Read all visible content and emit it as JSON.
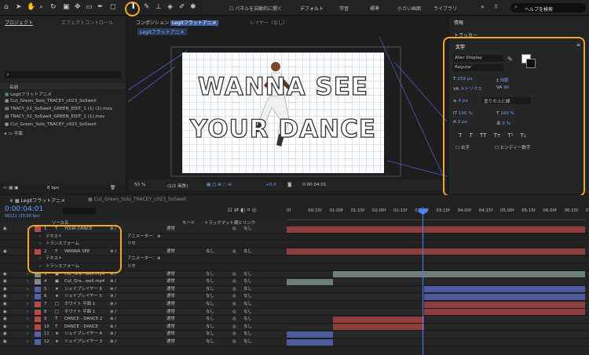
{
  "toolbar": {
    "auto_open": "パネルを自動的に開く",
    "workspaces": [
      "デフォルト",
      "学習",
      "標準",
      "小さい画面",
      "ライブラリ"
    ],
    "search_placeholder": "ヘルプを検索"
  },
  "project": {
    "tab_project": "プロジェクト",
    "tab_effects": "エフェクトコントロール",
    "search_glyph": "⌕",
    "col_name": "名前",
    "items": [
      "Legitフラットアニメ",
      "Cut_Green_Solo_TRACEY_c023_SoSwell",
      "TRACY_02_SoSwell_GREEN_EDIT_1 (1) (1).mov",
      "TRACY_02_SoSwell_GREEN_EDIT_1 (1).mov",
      "Cut_Green_Solo_TRACEY_c023_SoSwell",
      "平面"
    ],
    "bpc": "8 bpc"
  },
  "comp": {
    "tab": "コンポジション",
    "comp_name": "Legitフラットアニメ",
    "layer_tab": "レイヤー（なし）",
    "subtab": "Legitフラットアニメ",
    "line1": "WANNA SEE",
    "line2": "YOUR DANCE",
    "zoom": "50 %",
    "quality": "(1/2 画質)",
    "exposure": "+0.0",
    "time": "0:00:04:01"
  },
  "right": {
    "info": "情報",
    "tracker": "トラッカー",
    "char_title": "文字",
    "font": "Aller Display",
    "style": "Regular",
    "size": "259 px",
    "leading": "自動",
    "kerning": "メトリクス",
    "tracking": "96",
    "stroke_width": "4 px",
    "stroke_mode": "塗りの上に線",
    "vscale": "100 %",
    "hscale": "100 %",
    "baseline": "0 px",
    "tsume": "0 %",
    "styles": [
      "T",
      "T",
      "TT",
      "Tт",
      "T¹",
      "T₁"
    ],
    "opt1": "合字",
    "opt2": "ヒンディー数字"
  },
  "timeline": {
    "tab1": "Legitフラットアニメ",
    "tab2": "Cut_Green_Solo_TRACEY_c023_SoSwell",
    "timecode": "0:00:04:01",
    "frame_info": "00121 (30.00 fps)",
    "col_source": "ソース名",
    "col_mode": "モード",
    "col_trk": "トラックマット",
    "col_parent": "親とリンク",
    "ruler": [
      "0f",
      "00:15f",
      "01:00f",
      "01:15f",
      "02:00f",
      "02:15f",
      "03:00f",
      "03:15f",
      "04:00f",
      "04:15f",
      "05:00f",
      "05:15f",
      "06:00f",
      "06:15f",
      "07:00f"
    ],
    "layers": [
      {
        "num": "1",
        "type": "T",
        "name": "YOUR DANCE",
        "mode": "通常",
        "trk": "",
        "parent": "なし",
        "color": "#b94a4a",
        "bar": "#8e3e3e",
        "start": 0,
        "end": 1
      },
      {
        "num": "",
        "type": "",
        "name": "テキスト",
        "mode": "",
        "trk": "",
        "parent": "",
        "color": "",
        "bar": "",
        "start": 0,
        "end": 0,
        "extra": "アニメーター："
      },
      {
        "num": "",
        "type": "",
        "name": "トランスフォーム",
        "mode": "",
        "trk": "",
        "parent": "",
        "color": "",
        "bar": "",
        "start": 0,
        "end": 0,
        "extra": "リセ"
      },
      {
        "num": "2",
        "type": "T",
        "name": "WANNA SEE",
        "mode": "通常",
        "trk": "なし",
        "parent": "なし",
        "color": "#b94a4a",
        "bar": "#8e3e3e",
        "start": 0,
        "end": 1
      },
      {
        "num": "",
        "type": "",
        "name": "テキスト",
        "mode": "",
        "trk": "",
        "parent": "",
        "color": "",
        "bar": "",
        "start": 0,
        "end": 0,
        "extra": "アニメーター："
      },
      {
        "num": "",
        "type": "",
        "name": "トランスフォーム",
        "mode": "",
        "trk": "",
        "parent": "",
        "color": "",
        "bar": "",
        "start": 0,
        "end": 0,
        "extra": "リセ"
      },
      {
        "num": "3",
        "type": "▣",
        "name": "Cut_Gra...well.mp4",
        "mode": "通常",
        "trk": "なし",
        "parent": "なし",
        "color": "#7d8c86",
        "bar": "#6e7f79",
        "start": 0.155,
        "end": 1
      },
      {
        "num": "4",
        "type": "▣",
        "name": "Cut_Gra...well.mp4",
        "mode": "通常",
        "trk": "なし",
        "parent": "なし",
        "color": "#7d8c86",
        "bar": "#6e7f79",
        "start": 0,
        "end": 0.155
      },
      {
        "num": "5",
        "type": "★",
        "name": "シェイプレイヤー 6",
        "mode": "通常",
        "trk": "なし",
        "parent": "なし",
        "color": "#5560a8",
        "bar": "#4d5aa0",
        "start": 0.46,
        "end": 1
      },
      {
        "num": "6",
        "type": "★",
        "name": "シェイプレイヤー 5",
        "mode": "通常",
        "trk": "なし",
        "parent": "なし",
        "color": "#5560a8",
        "bar": "#4d5aa0",
        "start": 0.46,
        "end": 1
      },
      {
        "num": "7",
        "type": "□",
        "name": "ホワイト 平面 1",
        "mode": "通常",
        "trk": "なし",
        "parent": "なし",
        "color": "#b94a4a",
        "bar": "#8e3e3e",
        "start": 0.46,
        "end": 1
      },
      {
        "num": "8",
        "type": "□",
        "name": "ホワイト 平面 1",
        "mode": "通常",
        "trk": "なし",
        "parent": "なし",
        "color": "#b94a4a",
        "bar": "#8e3e3e",
        "start": 0.46,
        "end": 1
      },
      {
        "num": "9",
        "type": "T",
        "name": "DANCE - DANCE 2",
        "mode": "通常",
        "trk": "なし",
        "parent": "なし",
        "color": "#b94a4a",
        "bar": "#8e3e3e",
        "start": 0.155,
        "end": 0.46
      },
      {
        "num": "10",
        "type": "T",
        "name": "DANCE - DANCE",
        "mode": "通常",
        "trk": "なし",
        "parent": "なし",
        "color": "#b94a4a",
        "bar": "#8e3e3e",
        "start": 0.155,
        "end": 0.46
      },
      {
        "num": "11",
        "type": "★",
        "name": "シェイプレイヤー 4",
        "mode": "通常",
        "trk": "なし",
        "parent": "なし",
        "color": "#5560a8",
        "bar": "#4d5aa0",
        "start": 0,
        "end": 0.155
      },
      {
        "num": "12",
        "type": "★",
        "name": "シェイプレイヤー 3",
        "mode": "通常",
        "trk": "なし",
        "parent": "なし",
        "color": "#5560a8",
        "bar": "#4d5aa0",
        "start": 0,
        "end": 0.155
      }
    ]
  }
}
